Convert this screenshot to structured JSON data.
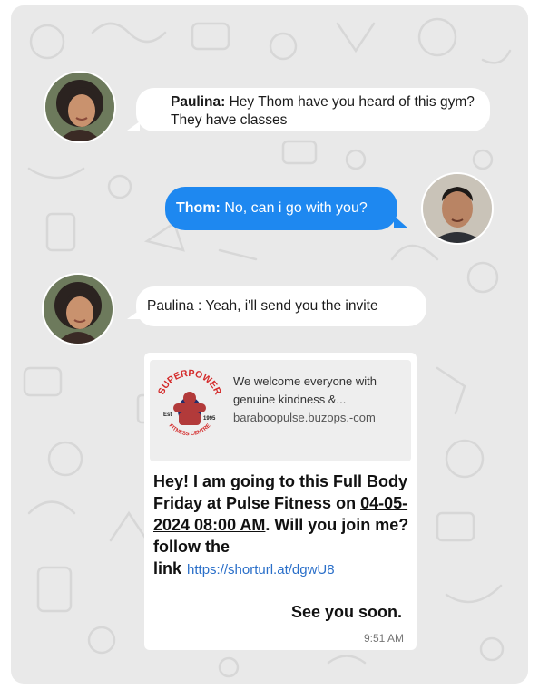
{
  "chat": {
    "messages": [
      {
        "sender": "Paulina:",
        "text": "Hey Thom have you heard of this gym? They have classes"
      },
      {
        "sender": "Thom:",
        "text": "No, can i go with you?"
      },
      {
        "sender": "Paulina :",
        "text": "Yeah, i'll send you the invite"
      }
    ],
    "link_card": {
      "logo_text": {
        "top": "SUPERPOWER",
        "bottom": "FITNESS CENTRE",
        "est": "Est",
        "year": "1995"
      },
      "preview_description": "We welcome everyone with genuine kindness &...",
      "preview_domain": "baraboopulse.buzops.-com",
      "body_start": "Hey! I am going to this Full Body Friday at Pulse Fitness on ",
      "body_datetime": "04-05-2024 08:00 AM",
      "body_end": ". Will you join me? follow the link",
      "link": "https://shorturl.at/dgwU8",
      "closing": "See you soon.",
      "time": "9:51 AM"
    }
  },
  "colors": {
    "chat_background": "#e9e9e9",
    "outgoing_bubble": "#1e88f0",
    "incoming_bubble": "#ffffff",
    "link": "#2a6fc9"
  },
  "icons": [
    "paulina-avatar",
    "thom-avatar",
    "superpower-fitness-logo"
  ]
}
